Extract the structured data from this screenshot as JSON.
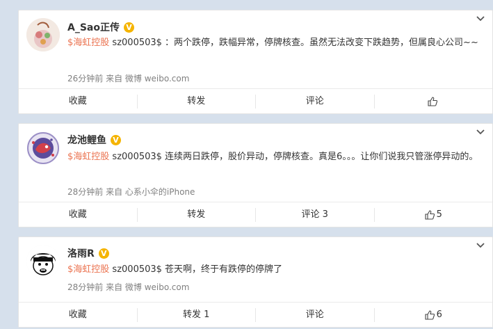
{
  "posts": [
    {
      "user": "A_Sao正传",
      "verified": "V",
      "stock_tag": "$海虹控股 sz000503$",
      "stock_name": "海虹控股",
      "text_before": "$",
      "text_stock": "海虹控股",
      "text_after": " sz000503$ ：两个跌停，跌幅异常，停牌核查。虽然无法改变下跌趋势，但属良心公司~~",
      "meta": "26分钟前 来自 微博 weibo.com",
      "actions": {
        "fav": "收藏",
        "repost": "转发",
        "comment": "评论",
        "like": ""
      }
    },
    {
      "user": "龙池鲤鱼",
      "verified": "V",
      "text_before": "$",
      "text_stock": "海虹控股",
      "text_after": " sz000503$ 连续两日跌停，股价异动，停牌核查。真是6。。。让你们说我只管涨停异动的。",
      "meta": "28分钟前 来自 心系小伞的iPhone",
      "actions": {
        "fav": "收藏",
        "repost": "转发",
        "comment": "评论 3",
        "like": "5"
      }
    },
    {
      "user": "洛雨R",
      "verified": "V",
      "text_before": "$",
      "text_stock": "海虹控股",
      "text_after": " sz000503$ 苍天啊，终于有跌停的停牌了",
      "meta": "28分钟前 来自 微博 weibo.com",
      "actions": {
        "fav": "收藏",
        "repost": "转发 1",
        "comment": "评论",
        "like": "6"
      }
    }
  ],
  "colors": {
    "stock_link": "#eb7350",
    "verified_badge": "#f5b400",
    "page_bg": "#d6e0ec"
  },
  "icons": {
    "like": "thumbs-up-icon",
    "more": "chevron-down-icon"
  }
}
